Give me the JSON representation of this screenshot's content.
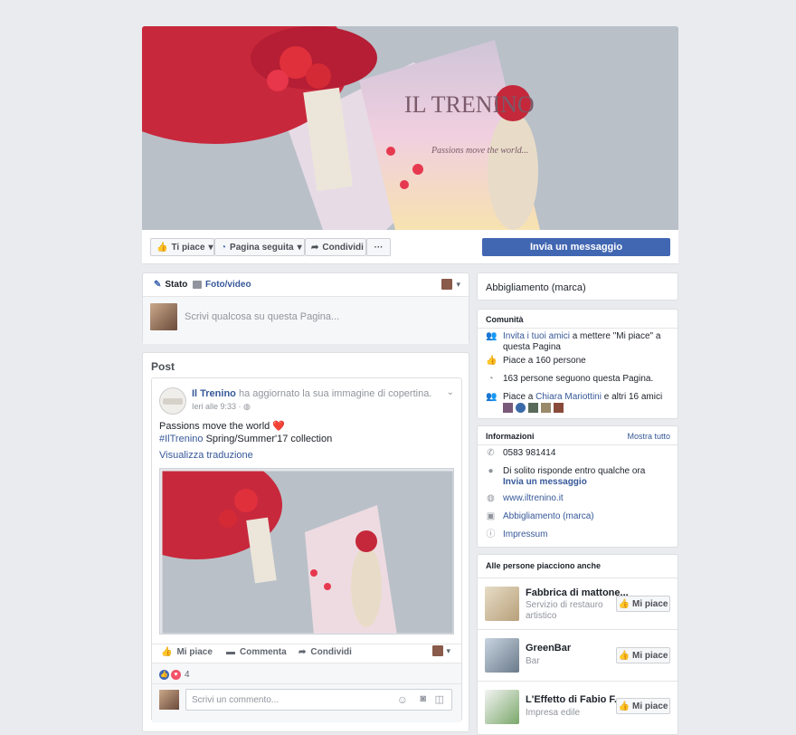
{
  "cover": {
    "brand_text": "IL TRENINO",
    "tagline": "Passions move the world..."
  },
  "actions": {
    "like_label": "Ti piace",
    "follow_label": "Pagina seguita",
    "share_label": "Condividi",
    "more_label": "···",
    "message_label": "Invia un messaggio"
  },
  "composer": {
    "tab_status": "Stato",
    "tab_photo": "Foto/video",
    "placeholder": "Scrivi qualcosa su questa Pagina..."
  },
  "posts": {
    "section_title": "Post",
    "author": "Il Trenino",
    "action_text": "ha aggiornato la sua immagine di copertina.",
    "time": "Ieri alle 9:33 · ",
    "body_line1": "Passions move the world",
    "hashtag": "#IlTrenino",
    "body_line2_rest": " Spring/Summer'17 collection",
    "translate_link": "Visualizza traduzione",
    "like_action": "Mi piace",
    "comment_action": "Commenta",
    "share_action": "Condividi",
    "reaction_count": "4",
    "comment_placeholder": "Scrivi un commento..."
  },
  "sidebar": {
    "category": "Abbigliamento (marca)",
    "community": {
      "title": "Comunità",
      "invite_link": "Invita i tuoi amici",
      "invite_rest": " a mettere \"Mi piace\" a questa Pagina",
      "likes": "Piace a 160 persone",
      "follows": "163 persone seguono questa Pagina.",
      "friends_prefix": "Piace a ",
      "friend_name": "Chiara Mariottini",
      "friends_suffix": " e altri 16 amici"
    },
    "info": {
      "title": "Informazioni",
      "show_all": "Mostra tutto",
      "phone": "0583 981414",
      "response": "Di solito risponde entro qualche ora",
      "send_message": "Invia un messaggio",
      "website": "www.iltrenino.it",
      "category_link": "Abbigliamento (marca)",
      "impressum": "Impressum"
    },
    "suggestions": {
      "title": "Alle persone piacciono anche",
      "like_label": "Mi piace",
      "items": [
        {
          "name": "Fabbrica di mattone...",
          "category": "Servizio di restauro artistico"
        },
        {
          "name": "GreenBar",
          "category": "Bar"
        },
        {
          "name": "L'Effetto di Fabio F...",
          "category": "Impresa edile"
        }
      ]
    }
  },
  "colors": {
    "brand": "#4267b2",
    "link": "#365899",
    "background": "#e9ebee"
  }
}
